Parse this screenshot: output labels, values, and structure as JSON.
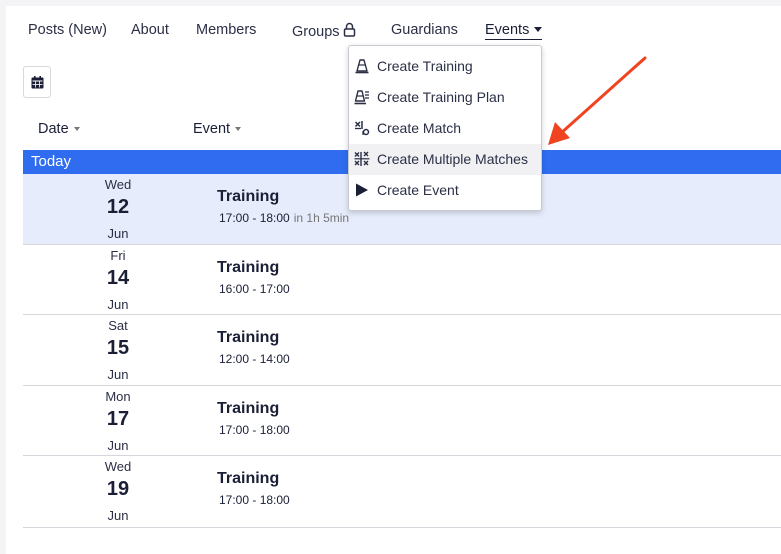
{
  "nav": {
    "items": [
      {
        "label": "Posts (New)"
      },
      {
        "label": "About"
      },
      {
        "label": "Members"
      },
      {
        "label": "Groups"
      },
      {
        "label": "Guardians"
      },
      {
        "label": "Events"
      }
    ]
  },
  "columns": {
    "date": "Date",
    "event": "Event"
  },
  "section": {
    "today": "Today"
  },
  "events": [
    {
      "dow": "Wed",
      "day": "12",
      "month": "Jun",
      "title": "Training",
      "time": "17:00 - 18:00",
      "relative": "in 1h 5min"
    },
    {
      "dow": "Fri",
      "day": "14",
      "month": "Jun",
      "title": "Training",
      "time": "16:00 - 17:00",
      "relative": ""
    },
    {
      "dow": "Sat",
      "day": "15",
      "month": "Jun",
      "title": "Training",
      "time": "12:00 - 14:00",
      "relative": ""
    },
    {
      "dow": "Mon",
      "day": "17",
      "month": "Jun",
      "title": "Training",
      "time": "17:00 - 18:00",
      "relative": ""
    },
    {
      "dow": "Wed",
      "day": "19",
      "month": "Jun",
      "title": "Training",
      "time": "17:00 - 18:00",
      "relative": ""
    }
  ],
  "dropdown": {
    "items": [
      {
        "label": "Create Training",
        "icon": "cone-icon"
      },
      {
        "label": "Create Training Plan",
        "icon": "training-plan-icon"
      },
      {
        "label": "Create Match",
        "icon": "match-icon"
      },
      {
        "label": "Create Multiple Matches",
        "icon": "multiple-matches-icon"
      },
      {
        "label": "Create Event",
        "icon": "play-icon"
      }
    ]
  },
  "colors": {
    "accent": "#2f6cf0",
    "highlight_row": "#e6ecfb",
    "annotation_arrow": "#f0431f"
  }
}
